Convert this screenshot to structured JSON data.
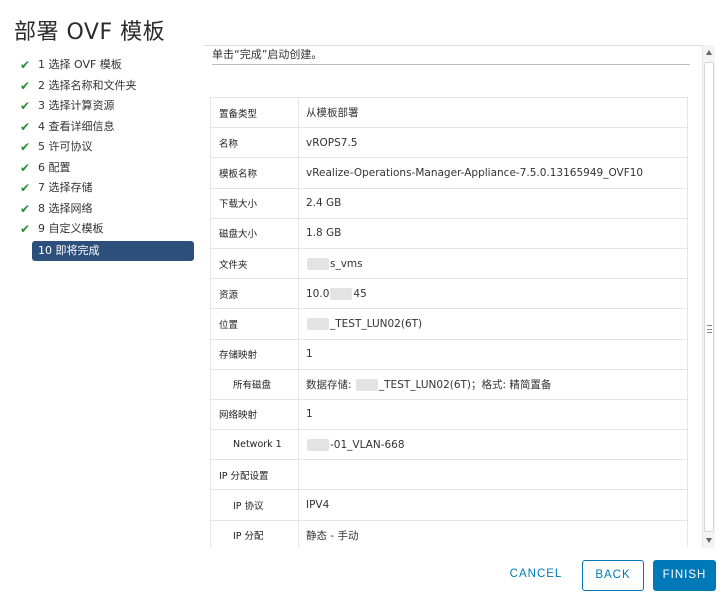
{
  "dialog": {
    "title": "部署 OVF 模板"
  },
  "steps": [
    {
      "label": "1 选择 OVF 模板",
      "done": true
    },
    {
      "label": "2 选择名称和文件夹",
      "done": true
    },
    {
      "label": "3 选择计算资源",
      "done": true
    },
    {
      "label": "4 查看详细信息",
      "done": true
    },
    {
      "label": "5 许可协议",
      "done": true
    },
    {
      "label": "6 配置",
      "done": true
    },
    {
      "label": "7 选择存储",
      "done": true
    },
    {
      "label": "8 选择网络",
      "done": true
    },
    {
      "label": "9 自定义模板",
      "done": true
    },
    {
      "label": "10 即将完成",
      "done": false,
      "active": true
    }
  ],
  "content": {
    "description": "单击“完成”启动创建。",
    "rows": [
      {
        "key": "置备类型",
        "value": "从模板部署"
      },
      {
        "key": "名称",
        "value": "vROPS7.5"
      },
      {
        "key": "模板名称",
        "value": "vRealize-Operations-Manager-Appliance-7.5.0.13165949_OVF10"
      },
      {
        "key": "下载大小",
        "value": "2.4 GB"
      },
      {
        "key": "磁盘大小",
        "value": "1.8 GB"
      },
      {
        "key": "文件夹",
        "value_pre": "",
        "value_post": "s_vms"
      },
      {
        "key": "资源",
        "value_pre": "10.0",
        "value_post": "45"
      },
      {
        "key": "位置",
        "value_pre": "",
        "value_post": "_TEST_LUN02(6T)"
      },
      {
        "key": "存储映射",
        "value": "1"
      },
      {
        "key": "所有磁盘",
        "value_pre": "数据存储: ",
        "value_post": "_TEST_LUN02(6T)；格式: 精简置备"
      },
      {
        "key": "网络映射",
        "value": "1"
      },
      {
        "key": "Network 1",
        "value_pre": "",
        "value_post": "-01_VLAN-668"
      },
      {
        "key": "IP 分配设置",
        "value": ""
      },
      {
        "key": "IP 协议",
        "value": "IPV4"
      },
      {
        "key": "IP 分配",
        "value": "静态 - 手动"
      }
    ]
  },
  "footer": {
    "cancel_label": "CANCEL",
    "back_label": "BACK",
    "finish_label": "FINISH"
  },
  "colors": {
    "accent": "#0079b8",
    "active_step": "#2d4f7c",
    "check": "#2e8b3a"
  }
}
